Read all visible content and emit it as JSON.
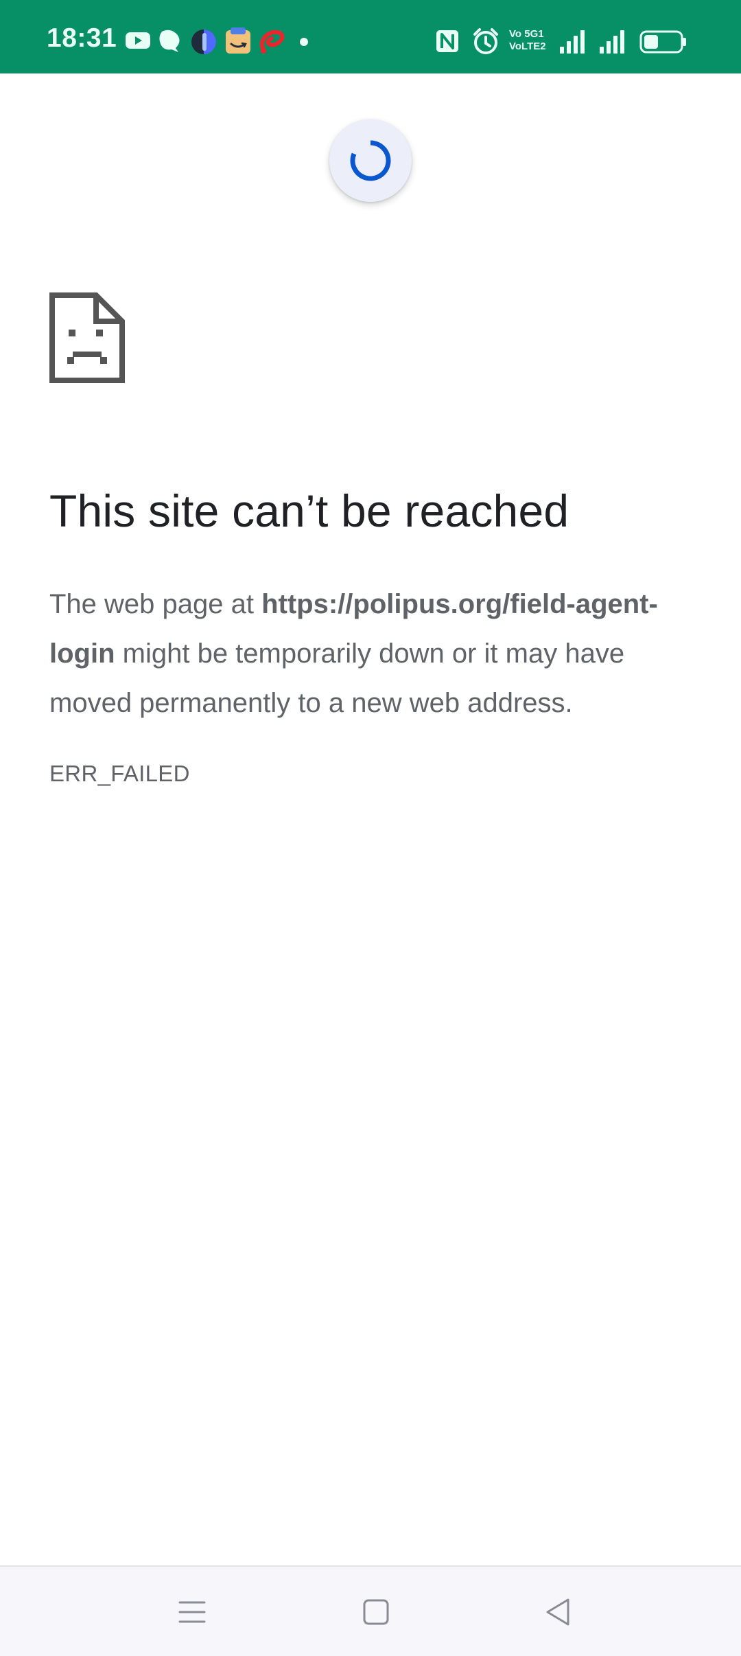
{
  "status_bar": {
    "time": "18:31",
    "background": "#078f66",
    "notification_icons": [
      "youtube-icon",
      "chat-bubble-icon",
      "half-circle-app-icon",
      "amazon-icon",
      "airtel-icon",
      "more-dot-icon"
    ],
    "system_icons": [
      "nfc-icon",
      "alarm-icon",
      "volte-icon",
      "signal-sim1-icon",
      "signal-sim2-icon",
      "battery-icon"
    ],
    "volte_line1": "Vo 5G1",
    "volte_line2": "VoLTE2"
  },
  "loader": {
    "accent": "#0b57d0",
    "background": "#eceff9"
  },
  "error": {
    "icon": "sad-document-icon",
    "title": "This site can’t be reached",
    "body_prefix": "The web page at ",
    "url": "https://polipus.org/field-agent-login",
    "body_suffix": " might be temporarily down or it may have moved permanently to a new web address.",
    "code": "ERR_FAILED"
  },
  "nav_bar": {
    "buttons": [
      "menu-icon",
      "home-icon",
      "back-icon"
    ]
  }
}
